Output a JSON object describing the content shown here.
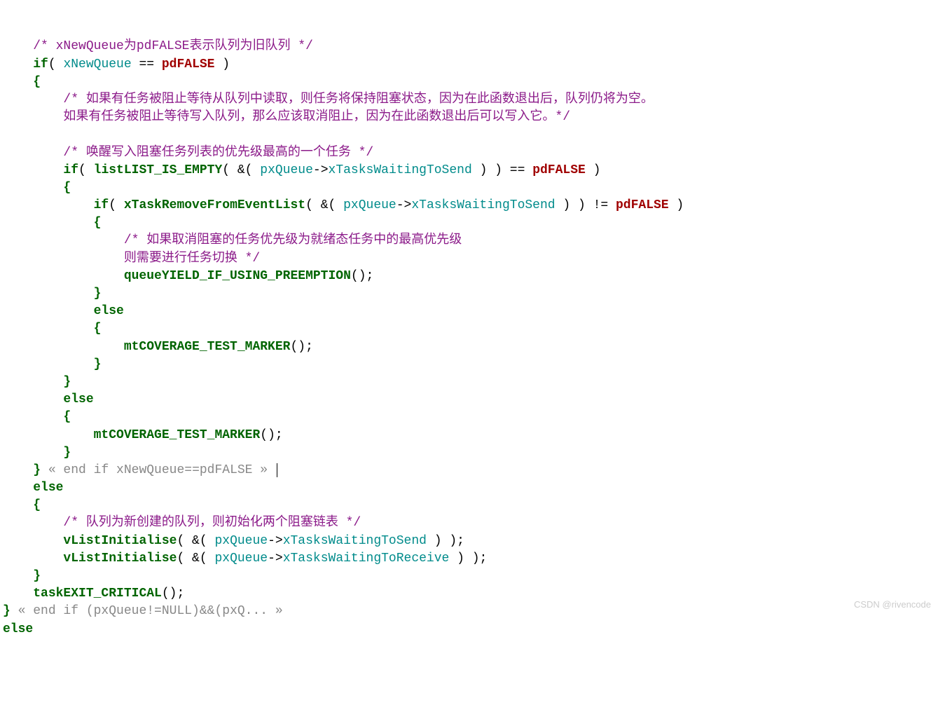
{
  "lines": {
    "l1_a": "/* xNewQueue",
    "l1_b": "为",
    "l1_c": "pdFALSE",
    "l1_d": "表示队列为旧队列 */",
    "l2_if": "if",
    "l2_p1": "( ",
    "l2_var": "xNewQueue",
    "l2_eq": " == ",
    "l2_false": "pdFALSE",
    "l2_p2": " )",
    "l3": "{",
    "l4": "/* 如果有任务被阻止等待从队列中读取，则任务将保持阻塞状态，因为在此函数退出后，队列仍将为空。",
    "l5": "如果有任务被阻止等待写入队列，那么应该取消阻止，因为在此函数退出后可以写入它。*/",
    "l7": "/* 唤醒写入阻塞任务列表的优先级最高的一个任务 */",
    "l8_if": "if",
    "l8_p1": "( ",
    "l8_fn": "listLIST_IS_EMPTY",
    "l8_p2": "( &( ",
    "l8_var": "pxQueue",
    "l8_arrow": "->",
    "l8_mem": "xTasksWaitingToSend",
    "l8_p3": " ) ) == ",
    "l8_false": "pdFALSE",
    "l8_p4": " )",
    "l9": "{",
    "l10_if": "if",
    "l10_p1": "( ",
    "l10_fn": "xTaskRemoveFromEventList",
    "l10_p2": "( &( ",
    "l10_var": "pxQueue",
    "l10_arrow": "->",
    "l10_mem": "xTasksWaitingToSend",
    "l10_p3": " ) ) != ",
    "l10_false": "pdFALSE",
    "l10_p4": " )",
    "l11": "{",
    "l12": "/* 如果取消阻塞的任务优先级为就绪态任务中的最高优先级",
    "l13": "则需要进行任务切换 */",
    "l14_fn": "queueYIELD_IF_USING_PREEMPTION",
    "l14_p": "();",
    "l15": "}",
    "l16_else": "else",
    "l17": "{",
    "l18_fn": "mtCOVERAGE_TEST_MARKER",
    "l18_p": "();",
    "l19": "}",
    "l20": "}",
    "l21_else": "else",
    "l22": "{",
    "l23_fn": "mtCOVERAGE_TEST_MARKER",
    "l23_p": "();",
    "l24": "}",
    "l25_a": "}",
    "l25_b": " « end if xNewQueue==pdFALSE » ",
    "l26_else": "else",
    "l27": "{",
    "l28": "/* 队列为新创建的队列，则初始化两个阻塞链表 */",
    "l29_fn": "vListInitialise",
    "l29_p1": "( &( ",
    "l29_var": "pxQueue",
    "l29_arrow": "->",
    "l29_mem": "xTasksWaitingToSend",
    "l29_p2": " ) );",
    "l30_fn": "vListInitialise",
    "l30_p1": "( &( ",
    "l30_var": "pxQueue",
    "l30_arrow": "->",
    "l30_mem": "xTasksWaitingToReceive",
    "l30_p2": " ) );",
    "l31": "}",
    "l32_fn": "taskEXIT_CRITICAL",
    "l32_p": "();",
    "l33_a": "}",
    "l33_b": " « end if (pxQueue!=NULL)&&(pxQ... »",
    "l34_else": "else"
  },
  "watermark": "CSDN @rivencode"
}
